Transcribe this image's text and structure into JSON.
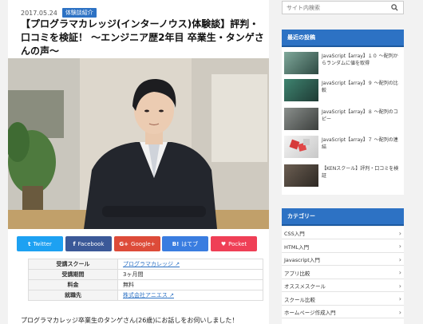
{
  "article": {
    "date": "2017.05.24",
    "category": "体験談紹介",
    "title": "【プログラマカレッジ(インターノウス)体験談】評判・口コミを検証！ 〜エンジニア歴2年目 卒業生・タンゲさんの声〜",
    "share": [
      {
        "label": "Twitter",
        "icon": "twitter-icon",
        "glyph": "t",
        "color": "#1da1f2"
      },
      {
        "label": "Facebook",
        "icon": "facebook-icon",
        "glyph": "f",
        "color": "#3b5998"
      },
      {
        "label": "Google+",
        "icon": "google-plus-icon",
        "glyph": "G+",
        "color": "#dd4b39"
      },
      {
        "label": "はてブ",
        "icon": "hatena-icon",
        "glyph": "B!",
        "color": "#3a7de0"
      },
      {
        "label": "Pocket",
        "icon": "pocket-icon",
        "glyph": "♥",
        "color": "#ef3f56"
      }
    ],
    "info_rows": [
      {
        "key": "受講スクール",
        "value": "プログラマカレッジ",
        "link": true
      },
      {
        "key": "受講期間",
        "value": "3ヶ月間",
        "link": false
      },
      {
        "key": "料金",
        "value": "無料",
        "link": false
      },
      {
        "key": "就職先",
        "value": "株式会社アニエス",
        "link": true
      }
    ],
    "intro": "プログラマカレッジ卒業生のタンゲさん(26歳)にお話しをお伺いしました！"
  },
  "sidebar": {
    "search_placeholder": "サイト内検索",
    "recent_heading": "最近の投稿",
    "recent": [
      {
        "title": "JavaScript【array】１０ 〜配列からランダムに値を取得",
        "thumb": "thumb-1"
      },
      {
        "title": "JavaScript【array】９ 〜配列の比較",
        "thumb": "thumb-2"
      },
      {
        "title": "JavaScript【array】８ 〜配列のコピー",
        "thumb": "thumb-3"
      },
      {
        "title": "JavaScript【array】７ 〜配列の連結",
        "thumb": "thumb-4"
      },
      {
        "title": "【KENスクール】評判・口コミを検証",
        "thumb": "thumb-5"
      }
    ],
    "category_heading": "カテゴリー",
    "categories": [
      "CSS入門",
      "HTML入門",
      "Javascript入門",
      "アプリ比較",
      "オススメスクール",
      "スクール比較",
      "ホームページ作成入門"
    ]
  },
  "colors": {
    "accent": "#2d72c4"
  }
}
